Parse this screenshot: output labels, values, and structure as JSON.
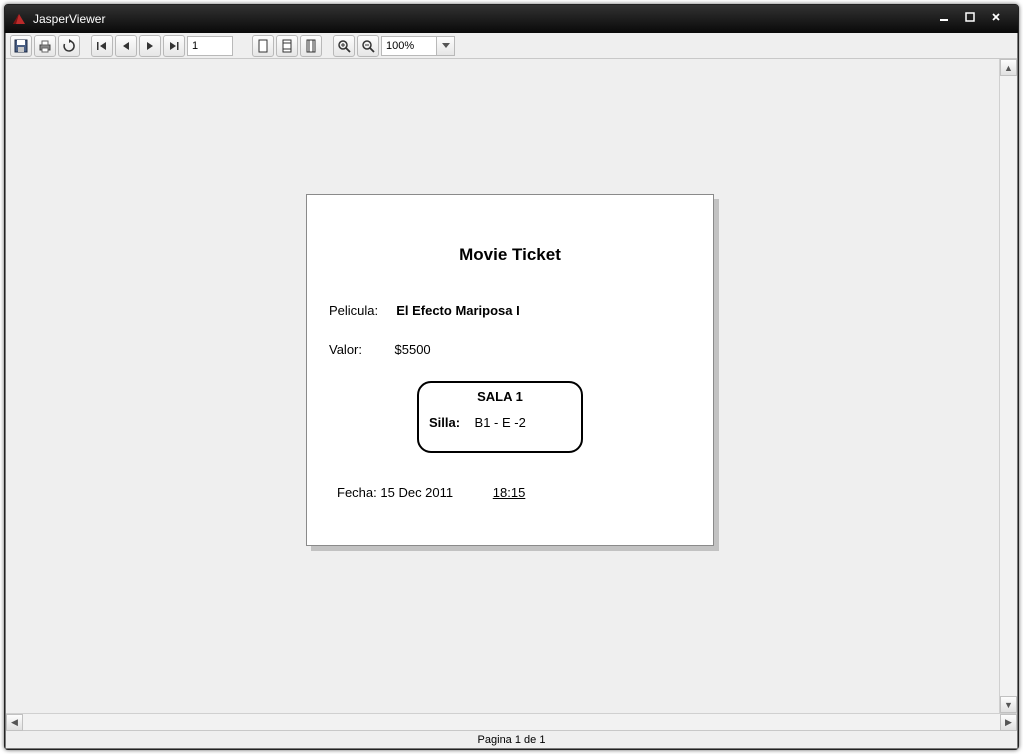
{
  "window": {
    "title": "JasperViewer"
  },
  "toolbar": {
    "page_field": "1",
    "zoom_value": "100%"
  },
  "status": {
    "text": "Pagina 1 de 1"
  },
  "ticket": {
    "title": "Movie Ticket",
    "movie_label": "Pelicula:",
    "movie_value": "El Efecto Mariposa I",
    "price_label": "Valor:",
    "price_value": "$5500",
    "room_label": "SALA  1",
    "seat_label": "Silla:",
    "seat_value": "B1 - E   -2",
    "date_label": "Fecha:",
    "date_value": "15 Dec 2011",
    "time_value": "18:15"
  }
}
